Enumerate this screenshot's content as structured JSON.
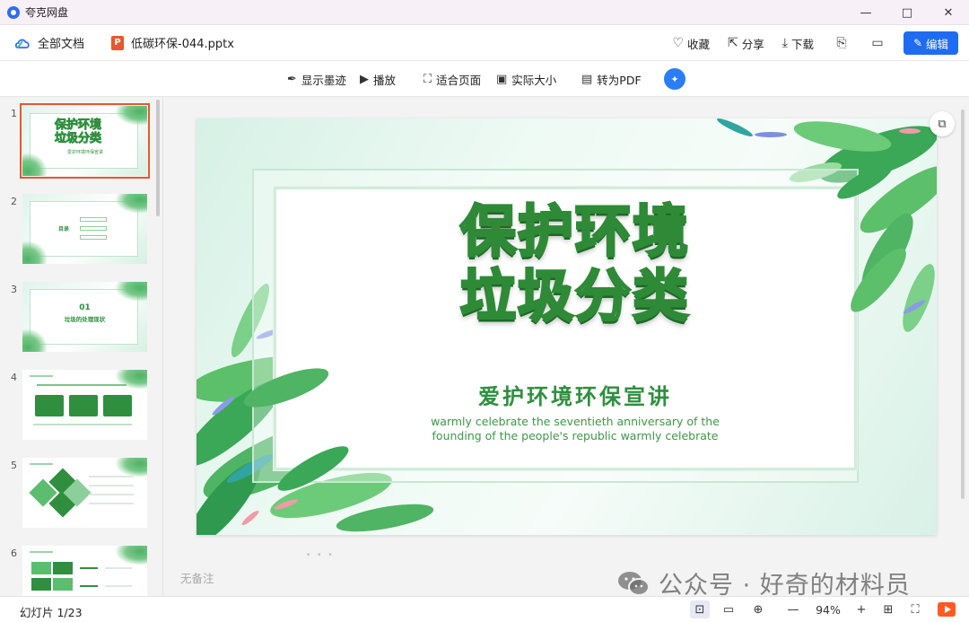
{
  "window": {
    "app_title": "夸克网盘",
    "controls": {
      "minimize": "—",
      "maximize": "□",
      "close": "✕"
    }
  },
  "header": {
    "all_docs": "全部文档",
    "file_badge": "P",
    "file_name": "低碳环保-044.pptx",
    "favorite": "收藏",
    "share": "分享",
    "download": "下载",
    "edit": "编辑"
  },
  "toolbar": {
    "show_ink": "显示墨迹",
    "play": "播放",
    "fit_page": "适合页面",
    "actual_size": "实际大小",
    "to_pdf": "转为PDF"
  },
  "thumbnails": {
    "items": [
      {
        "num": "1",
        "title": "保护环境\n垃圾分类",
        "sub": "爱护环境环保宣讲"
      },
      {
        "num": "2",
        "label": "目录"
      },
      {
        "num": "3",
        "number": "01",
        "label": "垃圾的处理现状"
      },
      {
        "num": "4"
      },
      {
        "num": "5"
      },
      {
        "num": "6"
      }
    ]
  },
  "slide": {
    "title_line1": "保护环境",
    "title_line2": "垃圾分类",
    "subtitle": "爱护环境环保宣讲",
    "en_line1": "warmly celebrate the seventieth anniversary of the",
    "en_line2": "founding of the people's republic warmly celebrate"
  },
  "notes_placeholder": "无备注",
  "watermark": "公众号 · 好奇的材料员",
  "status": {
    "slide_count": "幻灯片 1/23",
    "zoom": "94%"
  },
  "colors": {
    "accent_blue": "#1f6bf2",
    "brand_green": "#2f8f3e",
    "ppt_orange": "#e8572e"
  }
}
